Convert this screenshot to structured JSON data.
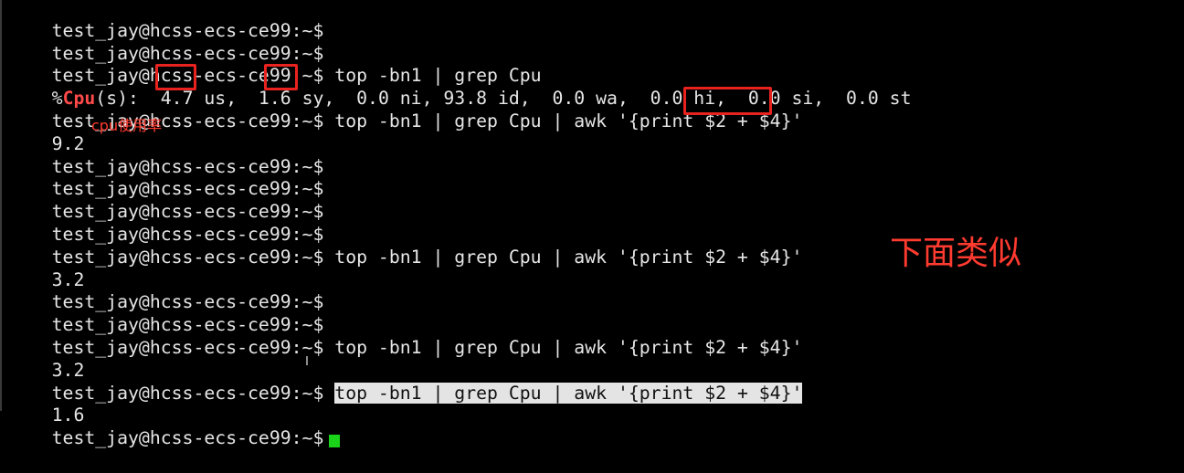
{
  "terminal": {
    "lines": [
      {
        "prompt": "test_jay@hcss-ecs-ce99:~$",
        "command": ""
      },
      {
        "prompt": "test_jay@hcss-ecs-ce99:~$",
        "command": ""
      },
      {
        "prompt": "test_jay@hcss-ecs-ce99:~$",
        "command": " top -bn1 | grep Cpu"
      },
      {
        "pct": "%",
        "cpu": "Cpu",
        "rest": "(s):  4.7 us,  1.6 sy,  0.0 ni, 93.8 id,  0.0 wa,  0.0 hi,  0.0 si,  0.0 st"
      },
      {
        "prompt": "test_jay@hcss-ecs-ce99:~$",
        "command": " top -bn1 | grep Cpu | awk '{print $2 + $4}'"
      },
      {
        "output": "9.2"
      },
      {
        "prompt": "test_jay@hcss-ecs-ce99:~$",
        "command": ""
      },
      {
        "prompt": "test_jay@hcss-ecs-ce99:~$",
        "command": ""
      },
      {
        "prompt": "test_jay@hcss-ecs-ce99:~$",
        "command": ""
      },
      {
        "prompt": "test_jay@hcss-ecs-ce99:~$",
        "command": ""
      },
      {
        "prompt": "test_jay@hcss-ecs-ce99:~$",
        "command": " top -bn1 | grep Cpu | awk '{print $2 + $4}'"
      },
      {
        "output": "3.2"
      },
      {
        "prompt": "test_jay@hcss-ecs-ce99:~$",
        "command": ""
      },
      {
        "prompt": "test_jay@hcss-ecs-ce99:~$",
        "command": ""
      },
      {
        "prompt": "test_jay@hcss-ecs-ce99:~$",
        "command": " top -bn1 | grep Cpu | awk '{print $2 + $4}'"
      },
      {
        "output": "3.2"
      },
      {
        "prompt": "test_jay@hcss-ecs-ce99:~$",
        "command": " ",
        "selected": "top -bn1 | grep Cpu | awk '{print $2 + $4}'"
      },
      {
        "output": "1.6"
      },
      {
        "prompt": "test_jay@hcss-ecs-ce99:~$",
        "command": ""
      }
    ]
  },
  "annotations": {
    "cpu_usage_note": "cpu使用率",
    "similar_below_note": "下面类似"
  },
  "colors": {
    "background": "#000000",
    "text": "#e6e6e6",
    "cpu_highlight": "#ff4a4a",
    "annotation_red": "#ff3b30",
    "cursor_green": "#19d419",
    "selection_bg": "#e4e4e4"
  }
}
